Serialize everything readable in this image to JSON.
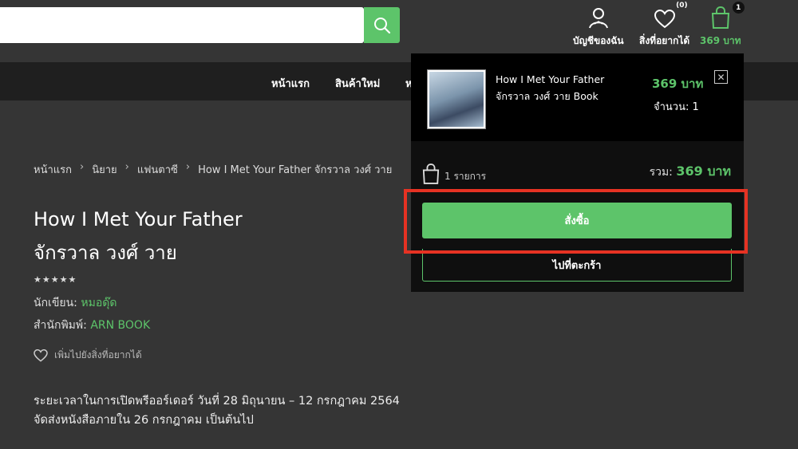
{
  "header": {
    "search_placeholder": "",
    "account_label": "บัญชีของฉัน",
    "wishlist_label": "สิ่งที่อยากได้",
    "wishlist_count": "(0)",
    "cart_count": "1",
    "cart_total": "369 บาท"
  },
  "nav": {
    "items": [
      "หน้าแรก",
      "สินค้าใหม่",
      "ห"
    ]
  },
  "breadcrumb": {
    "items": [
      "หน้าแรก",
      "นิยาย",
      "แฟนตาซี",
      "How I Met Your Father จักรวาล วงศ์ วาย"
    ],
    "separator": "›"
  },
  "product": {
    "title_line1": "How I Met Your Father",
    "title_line2": "จักรวาล วงศ์ วาย",
    "stars": "★★★★★",
    "author_label": "นักเขียน:",
    "author": "หมอดุ๊ด",
    "publisher_label": "สำนักพิมพ์:",
    "publisher": "ARN BOOK",
    "wishlist_link": "เพิ่มไปยังสิ่งที่อยากได้",
    "preorder_line1": "ระยะเวลาในการเปิดพรีออร์เดอร์ วันที่ 28 มิถุนายน – 12 กรกฎาคม 2564",
    "preorder_line2": "จัดส่งหนังสือภายใน 26 กรกฎาคม เป็นต้นไป"
  },
  "cart_dropdown": {
    "item_name_line1": "How I Met Your Father",
    "item_name_line2": "จักรวาล วงศ์ วาย Book",
    "item_price": "369 บาท",
    "item_qty": "จำนวน: 1",
    "remove_symbol": "✕",
    "item_count": "1 รายการ",
    "total_label": "รวม:",
    "total_amount": "369 บาท",
    "checkout_label": "สั่งซื้อ",
    "go_to_cart_label": "ไปที่ตะกร้า"
  },
  "colors": {
    "accent": "#5dc46a",
    "highlight": "#e63223",
    "background": "#353535",
    "nav_background": "#1f1f1f"
  }
}
